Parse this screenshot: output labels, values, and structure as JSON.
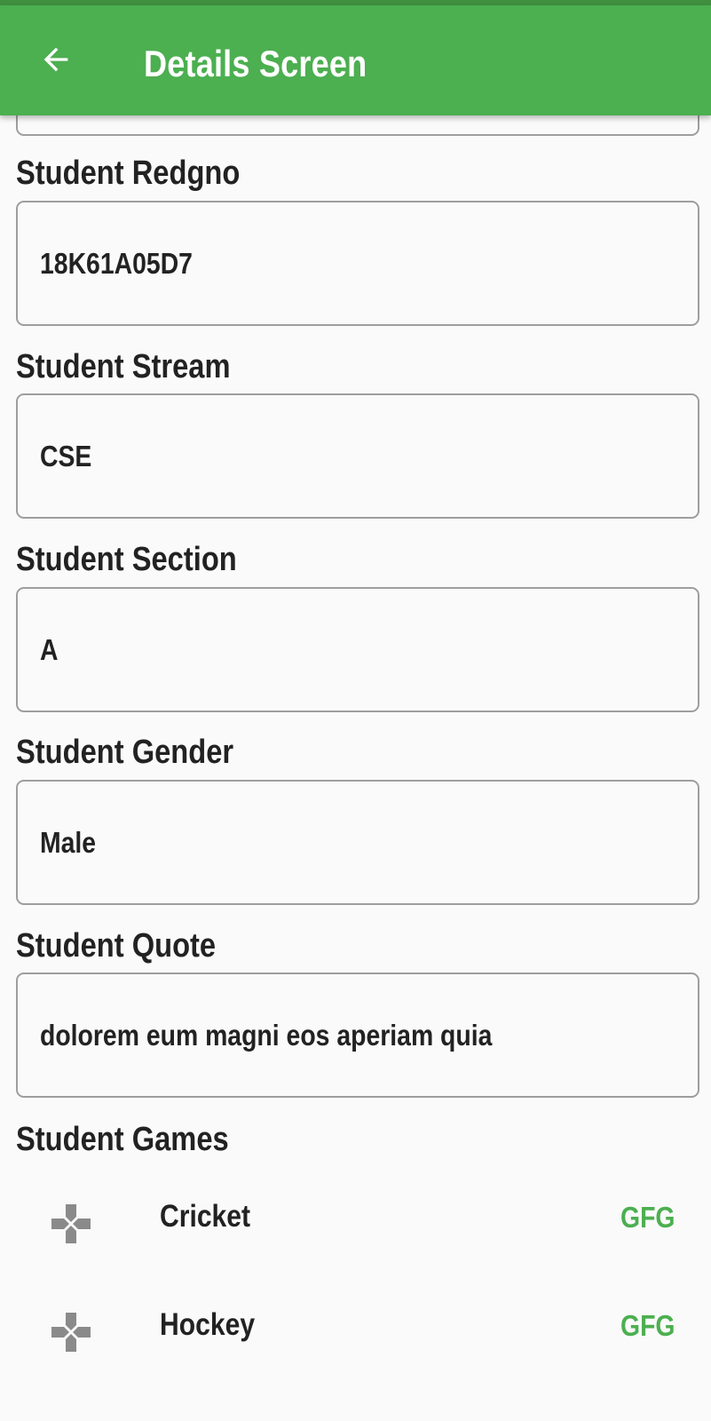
{
  "appbar": {
    "title": "Details Screen",
    "back_icon": "arrow-left-icon",
    "color": "#4caf50"
  },
  "fields": [
    {
      "label": "Student Redgno",
      "value": "18K61A05D7"
    },
    {
      "label": "Student Stream",
      "value": "CSE"
    },
    {
      "label": "Student Section",
      "value": "A"
    },
    {
      "label": "Student Gender",
      "value": "Male"
    },
    {
      "label": "Student Quote",
      "value": "dolorem eum magni eos aperiam quia"
    }
  ],
  "games": {
    "label": "Student Games",
    "items": [
      {
        "name": "Cricket",
        "badge": "GFG",
        "icon": "gamepad-icon"
      },
      {
        "name": "Hockey",
        "badge": "GFG",
        "icon": "gamepad-icon"
      }
    ]
  },
  "colors": {
    "accent": "#4caf50",
    "text": "#222222",
    "border": "#9e9e9e"
  }
}
